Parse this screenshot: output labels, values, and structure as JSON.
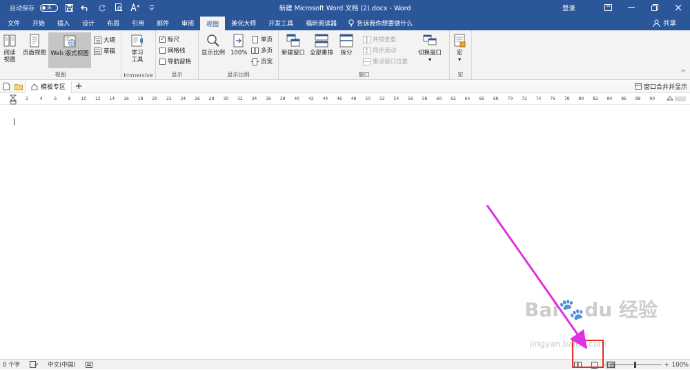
{
  "titlebar": {
    "autosave_label": "自动保存",
    "autosave_state": "关",
    "doc_title": "新建 Microsoft Word 文档 (2).docx  -  Word",
    "login": "登录"
  },
  "tabs": [
    "文件",
    "开始",
    "插入",
    "设计",
    "布局",
    "引用",
    "邮件",
    "审阅",
    "视图",
    "美化大师",
    "开发工具",
    "福昕阅读器"
  ],
  "active_tab": "视图",
  "tell_me": "告诉我你想要做什么",
  "share": "共享",
  "ribbon": {
    "views": {
      "label": "视图",
      "read": "阅读\n视图",
      "read_l1": "阅读",
      "read_l2": "视图",
      "print": "页面视图",
      "web": "Web 版式视图",
      "outline": "大纲",
      "draft": "草稿"
    },
    "immersive": {
      "label": "Immersive",
      "btn_l1": "学习",
      "btn_l2": "工具"
    },
    "show": {
      "label": "显示",
      "ruler": "标尺",
      "gridlines": "网格线",
      "nav": "导航窗格"
    },
    "zoom": {
      "label": "显示比例",
      "zoom_btn": "显示比例",
      "hundred": "100%",
      "one_page": "单页",
      "multi_page": "多页",
      "page_width": "页宽"
    },
    "window": {
      "label": "窗口",
      "new_window": "新建窗口",
      "arrange_all": "全部重排",
      "split": "拆分",
      "side_by_side": "并排查看",
      "sync_scroll": "同步滚动",
      "reset_pos": "重设窗口位置",
      "switch": "切换窗口"
    },
    "macros": {
      "label": "宏",
      "btn": "宏"
    }
  },
  "tabbar": {
    "template_tab": "模板专区",
    "merge": "窗口合并并显示"
  },
  "ruler_ticks": [
    "2",
    "4",
    "6",
    "8",
    "10",
    "12",
    "14",
    "16",
    "18",
    "20",
    "22",
    "24",
    "26",
    "28",
    "30",
    "32",
    "34",
    "36",
    "38",
    "40",
    "42",
    "44",
    "46",
    "48",
    "50",
    "52",
    "54",
    "56",
    "58",
    "60",
    "62",
    "64",
    "66",
    "68",
    "70",
    "72",
    "74",
    "76",
    "78",
    "80",
    "82",
    "84",
    "86",
    "88",
    "90"
  ],
  "status": {
    "words": "0 个字",
    "language": "中文(中国)",
    "zoom": "100%",
    "zoom_level_percent": 100
  },
  "watermark": {
    "brand": "Bai du 经验",
    "url": "jingyan.baidu.com"
  },
  "colors": {
    "accent": "#2b579a",
    "highlight": "#e52b2b",
    "arrow": "#e030e0"
  }
}
